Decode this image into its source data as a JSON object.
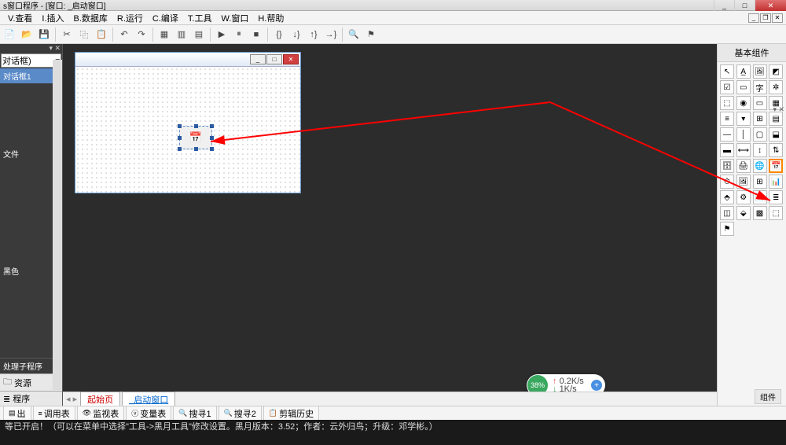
{
  "title": "s窗口程序 - [窗口: _启动窗口]",
  "menu": {
    "view": "V.查看",
    "insert": "I.插入",
    "database": "B.数据库",
    "run": "R.运行",
    "compile": "C.编译",
    "tools": "T.工具",
    "window": "W.窗口",
    "help": "H.帮助"
  },
  "left": {
    "combo": "对话框)",
    "item1": "对话框1",
    "item_file": "文件",
    "item_black": "黑色",
    "item_proc": "处理子程序",
    "tab_res": "资源",
    "tab_prog": "程序"
  },
  "form_tabs": {
    "start": "起始页",
    "window": "_启动窗口"
  },
  "right": {
    "header": "基本组件",
    "footer": "组件"
  },
  "status_tabs": {
    "out": "出",
    "debug": "调用表",
    "watch": "监视表",
    "var": "变量表",
    "search1": "搜寻1",
    "search2": "搜寻2",
    "clip": "剪辑历史"
  },
  "status_line": "等已开启！（可以在菜单中选择\"工具->黑月工具\"修改设置。黑月版本：3.52；作者：云外归鸟；升级：邓学彬。）",
  "speed": {
    "pct": "38%",
    "up": "0.2K/s",
    "down": "1K/s"
  }
}
